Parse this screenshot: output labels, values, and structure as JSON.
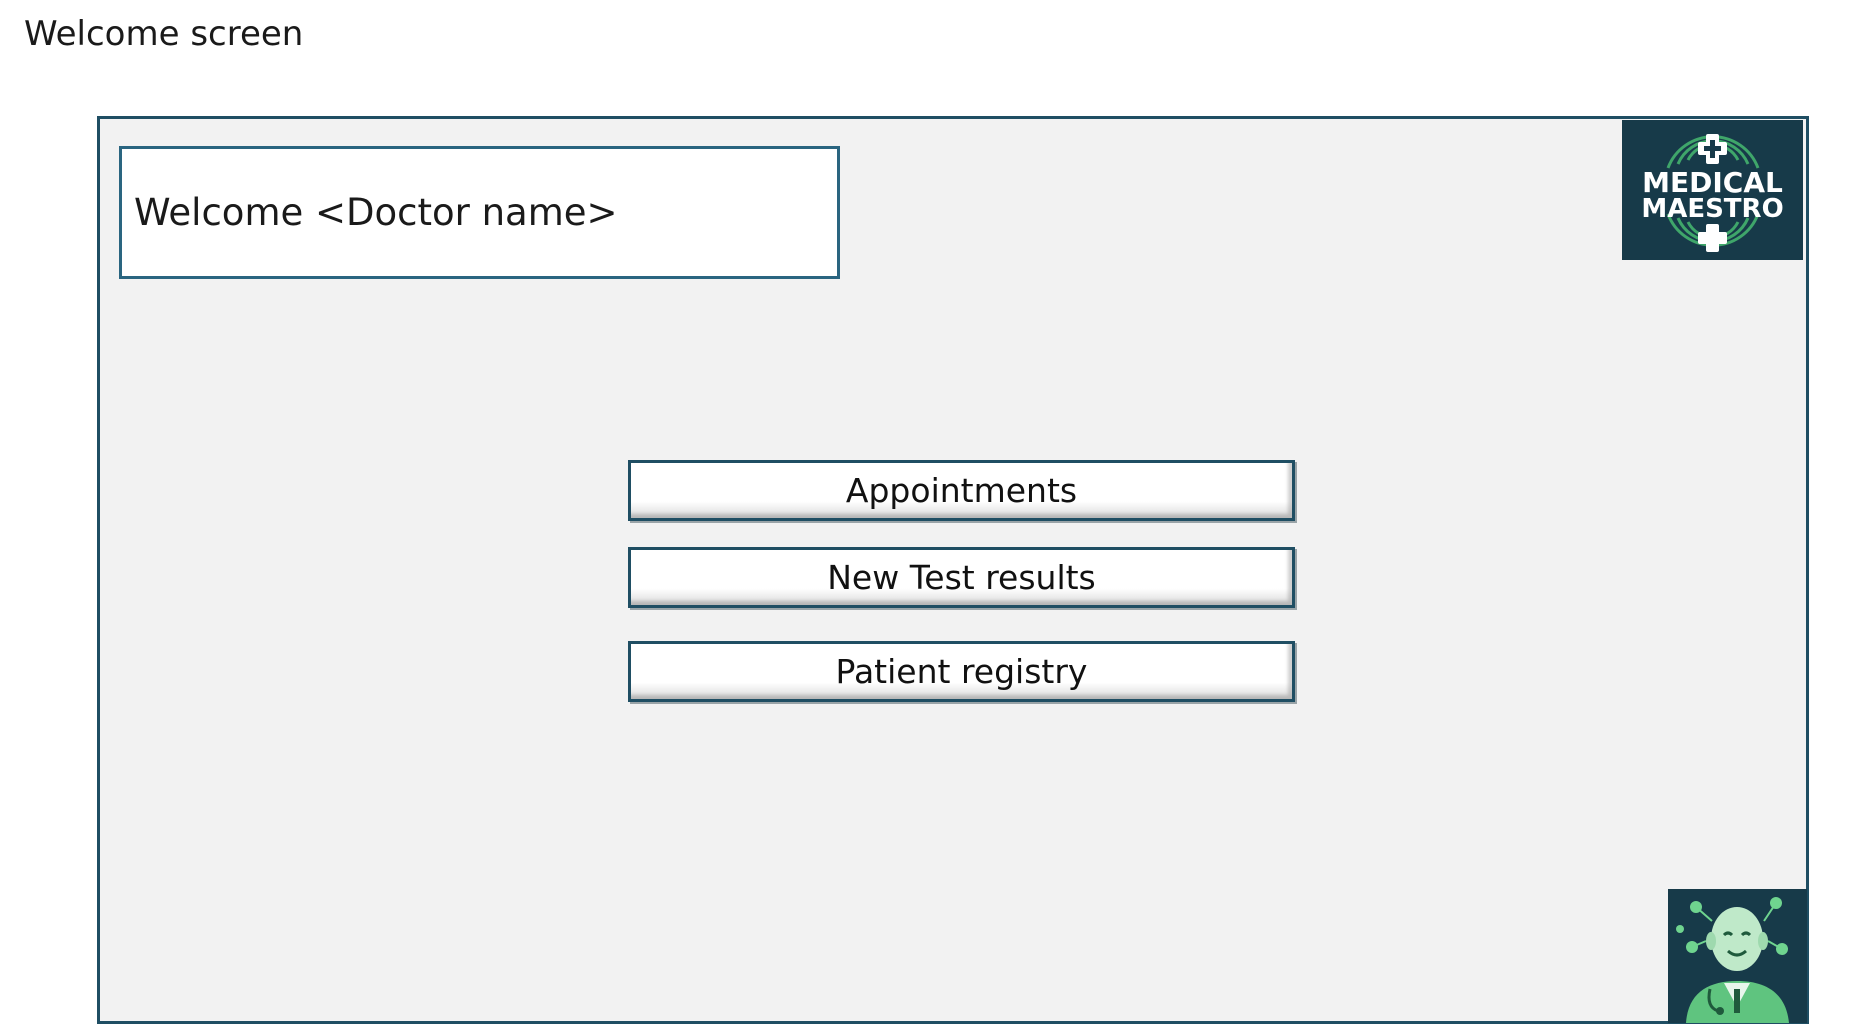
{
  "page_caption": "Welcome screen",
  "welcome": {
    "text": "Welcome <Doctor name>"
  },
  "logo": {
    "line1": "MEDICAL",
    "line2": "MAESTRO",
    "background": "#173a49",
    "accent": "#3fa66a"
  },
  "menu": {
    "buttons": [
      {
        "label": "Appointments"
      },
      {
        "label": "New Test results"
      },
      {
        "label": "Patient registry"
      }
    ]
  },
  "assistant": {
    "icon": "doctor-avatar-icon"
  },
  "colors": {
    "frame_border": "#1f4e63",
    "frame_background": "#f2f2f2"
  }
}
